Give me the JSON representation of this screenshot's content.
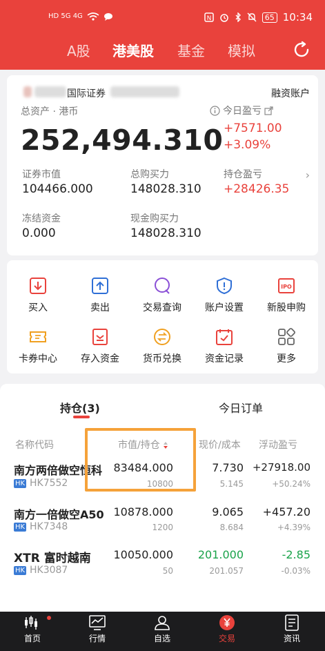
{
  "status_bar": {
    "left_text": "HD 5G 4G",
    "time": "10:34",
    "battery": "65"
  },
  "top_tabs": [
    "A股",
    "港美股",
    "基金",
    "模拟"
  ],
  "account": {
    "broker_name": "国际证券",
    "margin_account_label": "融资账户",
    "total_assets_label": "总资产 · 港币",
    "total_assets_value": "252,494.310",
    "today_pnl_label": "今日盈亏",
    "today_pnl_value": "+7571.00",
    "today_pnl_pct": "+3.09%",
    "securities_value_label": "证券市值",
    "securities_value": "104466.000",
    "total_buying_power_label": "总购买力",
    "total_buying_power": "148028.310",
    "position_pnl_label": "持仓盈亏",
    "position_pnl": "+28426.35",
    "frozen_funds_label": "冻结资金",
    "frozen_funds": "0.000",
    "cash_buying_power_label": "现金购买力",
    "cash_buying_power": "148028.310"
  },
  "functions": [
    {
      "label": "买入",
      "icon": "buy-icon"
    },
    {
      "label": "卖出",
      "icon": "sell-icon"
    },
    {
      "label": "交易查询",
      "icon": "query-icon"
    },
    {
      "label": "账户设置",
      "icon": "shield-icon"
    },
    {
      "label": "新股申购",
      "icon": "ipo-icon"
    },
    {
      "label": "卡券中心",
      "icon": "ticket-icon"
    },
    {
      "label": "存入资金",
      "icon": "deposit-icon"
    },
    {
      "label": "货币兑换",
      "icon": "exchange-icon"
    },
    {
      "label": "资金记录",
      "icon": "calendar-icon"
    },
    {
      "label": "更多",
      "icon": "more-icon"
    }
  ],
  "positions_tabs": {
    "holdings": "持仓(3)",
    "today_orders": "今日订单"
  },
  "table_headers": {
    "name_code": "名称代码",
    "value_qty": "市值/持仓",
    "price_cost": "现价/成本",
    "float_pnl": "浮动盈亏"
  },
  "holdings": [
    {
      "name": "南方两倍做空恒科",
      "market": "HK",
      "code": "HK7552",
      "market_value": "83484.000",
      "quantity": "10800",
      "price": "7.730",
      "cost": "5.145",
      "pnl": "+27918.00",
      "pnl_pct": "+50.24%"
    },
    {
      "name": "南方一倍做空A50",
      "market": "HK",
      "code": "HK7348",
      "market_value": "10878.000",
      "quantity": "1200",
      "price": "9.065",
      "cost": "8.684",
      "pnl": "+457.20",
      "pnl_pct": "+4.39%"
    },
    {
      "name": "XTR 富时越南",
      "market": "HK",
      "code": "HK3087",
      "market_value": "10050.000",
      "quantity": "50",
      "price": "201.000",
      "cost": "201.057",
      "pnl": "-2.85",
      "pnl_pct": "-0.03%"
    }
  ],
  "bottom_nav": [
    "首页",
    "行情",
    "自选",
    "交易",
    "资讯"
  ],
  "colors": {
    "brand_red": "#e9423c",
    "gain_red": "#e9423c",
    "loss_green": "#1aa34a",
    "highlight_orange": "#f5a23a",
    "nav_bg": "#1c1c1e"
  }
}
